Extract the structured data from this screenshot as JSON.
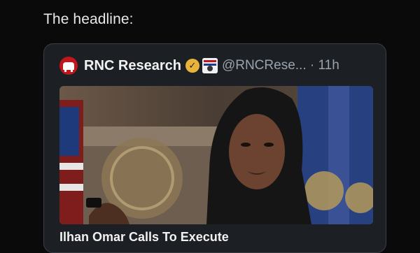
{
  "intro_text": "The headline:",
  "tweet": {
    "display_name": "RNC Research",
    "handle_time": "@RNCRese... · 11h",
    "headline": "Ilhan Omar Calls To Execute"
  },
  "colors": {
    "background": "#0a0a0b",
    "card_background": "#1c1f24",
    "card_border": "#3a3f46",
    "verified_badge": "#e8b33a",
    "avatar_red": "#c0161c"
  },
  "icons": {
    "avatar": "rnc-elephant-logo",
    "verified": "gold-checkmark-badge",
    "affiliate": "affiliate-badge"
  }
}
